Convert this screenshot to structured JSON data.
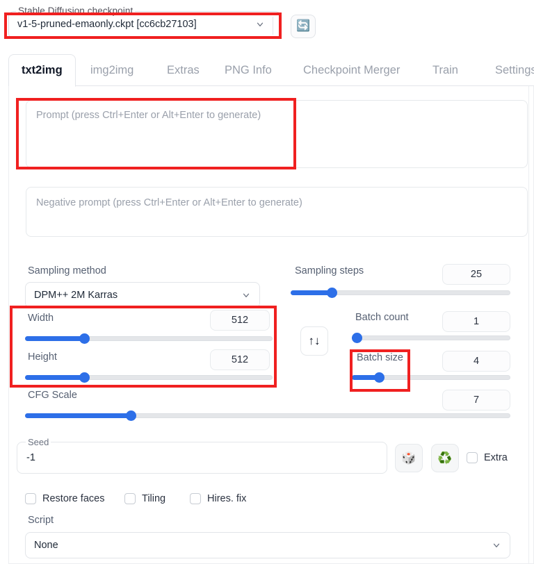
{
  "checkpoint": {
    "legend": "Stable Diffusion checkpoint",
    "value": "v1-5-pruned-emaonly.ckpt [cc6cb27103]",
    "refresh_icon": "refresh-icon",
    "refresh_glyph": "🔄"
  },
  "tabs": [
    {
      "label": "txt2img",
      "active": true
    },
    {
      "label": "img2img",
      "active": false
    },
    {
      "label": "Extras",
      "active": false
    },
    {
      "label": "PNG Info",
      "active": false
    },
    {
      "label": "Checkpoint Merger",
      "active": false
    },
    {
      "label": "Train",
      "active": false
    },
    {
      "label": "Settings",
      "active": false
    }
  ],
  "prompt": {
    "placeholder": "Prompt (press Ctrl+Enter or Alt+Enter to generate)",
    "value": ""
  },
  "negative_prompt": {
    "placeholder": "Negative prompt (press Ctrl+Enter or Alt+Enter to generate)",
    "value": ""
  },
  "sampling_method": {
    "label": "Sampling method",
    "value": "DPM++ 2M Karras"
  },
  "sampling_steps": {
    "label": "Sampling steps",
    "value": "25",
    "fill_percent": 18
  },
  "width": {
    "label": "Width",
    "value": "512",
    "fill_percent": 25
  },
  "height": {
    "label": "Height",
    "value": "512",
    "fill_percent": 25
  },
  "batch_count": {
    "label": "Batch count",
    "value": "1",
    "fill_percent": 2
  },
  "batch_size": {
    "label": "Batch size",
    "value": "4",
    "fill_percent": 12
  },
  "cfg_scale": {
    "label": "CFG Scale",
    "value": "7",
    "fill_percent": 22
  },
  "swap_button": {
    "label": "↑↓"
  },
  "seed": {
    "legend": "Seed",
    "value": "-1",
    "dice_glyph": "🎲",
    "recycle_glyph": "♻️",
    "extra_label": "Extra",
    "extra_checked": false
  },
  "toggles": [
    {
      "label": "Restore faces",
      "checked": false
    },
    {
      "label": "Tiling",
      "checked": false
    },
    {
      "label": "Hires. fix",
      "checked": false
    }
  ],
  "script": {
    "label": "Script",
    "value": "None"
  },
  "colors": {
    "accent_blue": "#2d6fe8",
    "annotation_red": "#f02020",
    "text_dark": "#1f2937",
    "text_muted": "#9aa0ab"
  }
}
